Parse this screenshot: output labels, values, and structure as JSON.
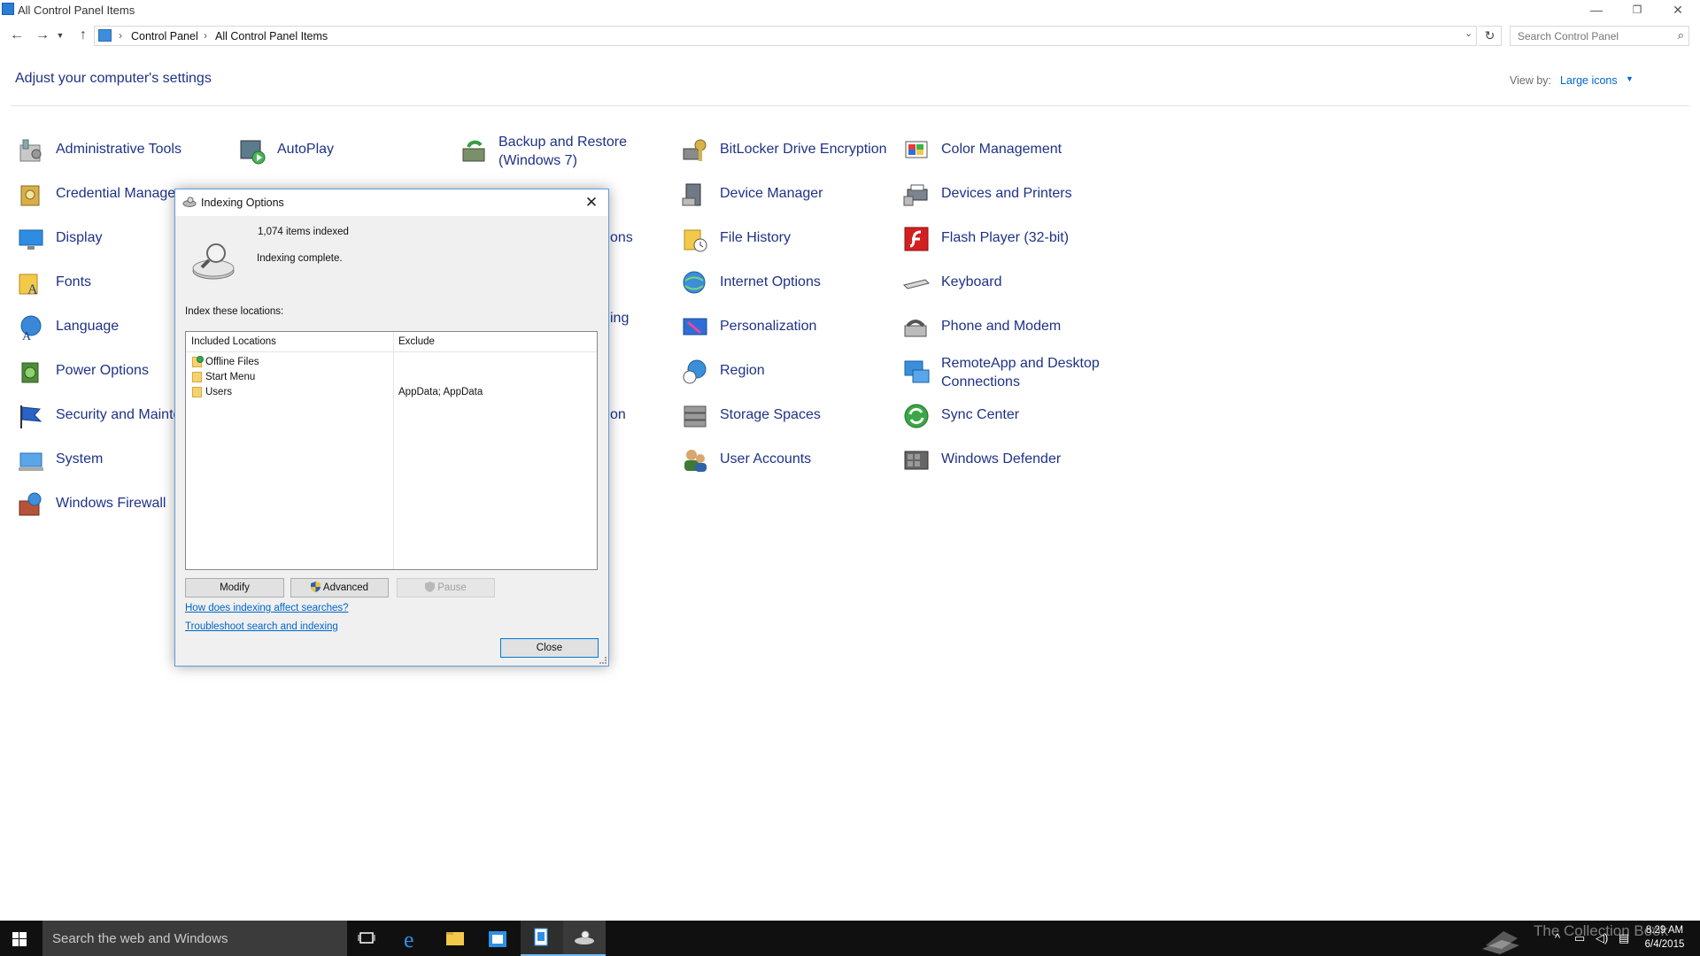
{
  "window": {
    "title": "All Control Panel Items",
    "minimize_glyph": "—",
    "restore_glyph": "❐",
    "close_glyph": "✕"
  },
  "address": {
    "crumbs": [
      "Control Panel",
      "All Control Panel Items"
    ],
    "search_placeholder": "Search Control Panel"
  },
  "content": {
    "heading": "Adjust your computer's settings",
    "view_by_label": "View by:",
    "view_by_value": "Large icons"
  },
  "items": {
    "administrative_tools": "Administrative Tools",
    "autoplay": "AutoPlay",
    "backup_restore_line1": "Backup and Restore",
    "backup_restore_line2": "(Windows 7)",
    "bitlocker": "BitLocker Drive Encryption",
    "color_management": "Color Management",
    "credential_manager": "Credential Manager",
    "device_manager": "Device Manager",
    "devices_printers": "Devices and Printers",
    "display": "Display",
    "file_history": "File History",
    "flash_player": "Flash Player (32-bit)",
    "fonts": "Fonts",
    "internet_options": "Internet Options",
    "keyboard": "Keyboard",
    "language": "Language",
    "personalization": "Personalization",
    "phone_modem": "Phone and Modem",
    "power_options": "Power Options",
    "region": "Region",
    "remoteapp_line1": "RemoteApp and Desktop",
    "remoteapp_line2": "Connections",
    "security_maintenance": "Security and Mainte",
    "storage_spaces": "Storage Spaces",
    "sync_center": "Sync Center",
    "system": "System",
    "user_accounts": "User Accounts",
    "windows_defender": "Windows Defender",
    "windows_firewall": "Windows Firewall",
    "partial_ons_1": "ons",
    "partial_ing": "ing",
    "partial_on": "on"
  },
  "dialog": {
    "title": "Indexing Options",
    "items_indexed": "1,074 items indexed",
    "status": "Indexing complete.",
    "index_locations_label": "Index these locations:",
    "columns": {
      "included": "Included Locations",
      "exclude": "Exclude"
    },
    "locations": [
      {
        "name": "Offline Files",
        "exclude": ""
      },
      {
        "name": "Start Menu",
        "exclude": ""
      },
      {
        "name": "Users",
        "exclude": "AppData; AppData"
      }
    ],
    "buttons": {
      "modify": "Modify",
      "advanced": "Advanced",
      "pause": "Pause",
      "close": "Close"
    },
    "links": {
      "how_indexing": "How does indexing affect searches?",
      "troubleshoot": "Troubleshoot search and indexing"
    },
    "close_glyph": "✕"
  },
  "taskbar": {
    "search_placeholder": "Search the web and Windows",
    "time": "8:29 AM",
    "date": "6/4/2015",
    "watermark": "The Collection Book"
  },
  "colors": {
    "link_blue": "#1e3287",
    "accent_blue": "#0078d7",
    "taskbar": "#101010"
  }
}
